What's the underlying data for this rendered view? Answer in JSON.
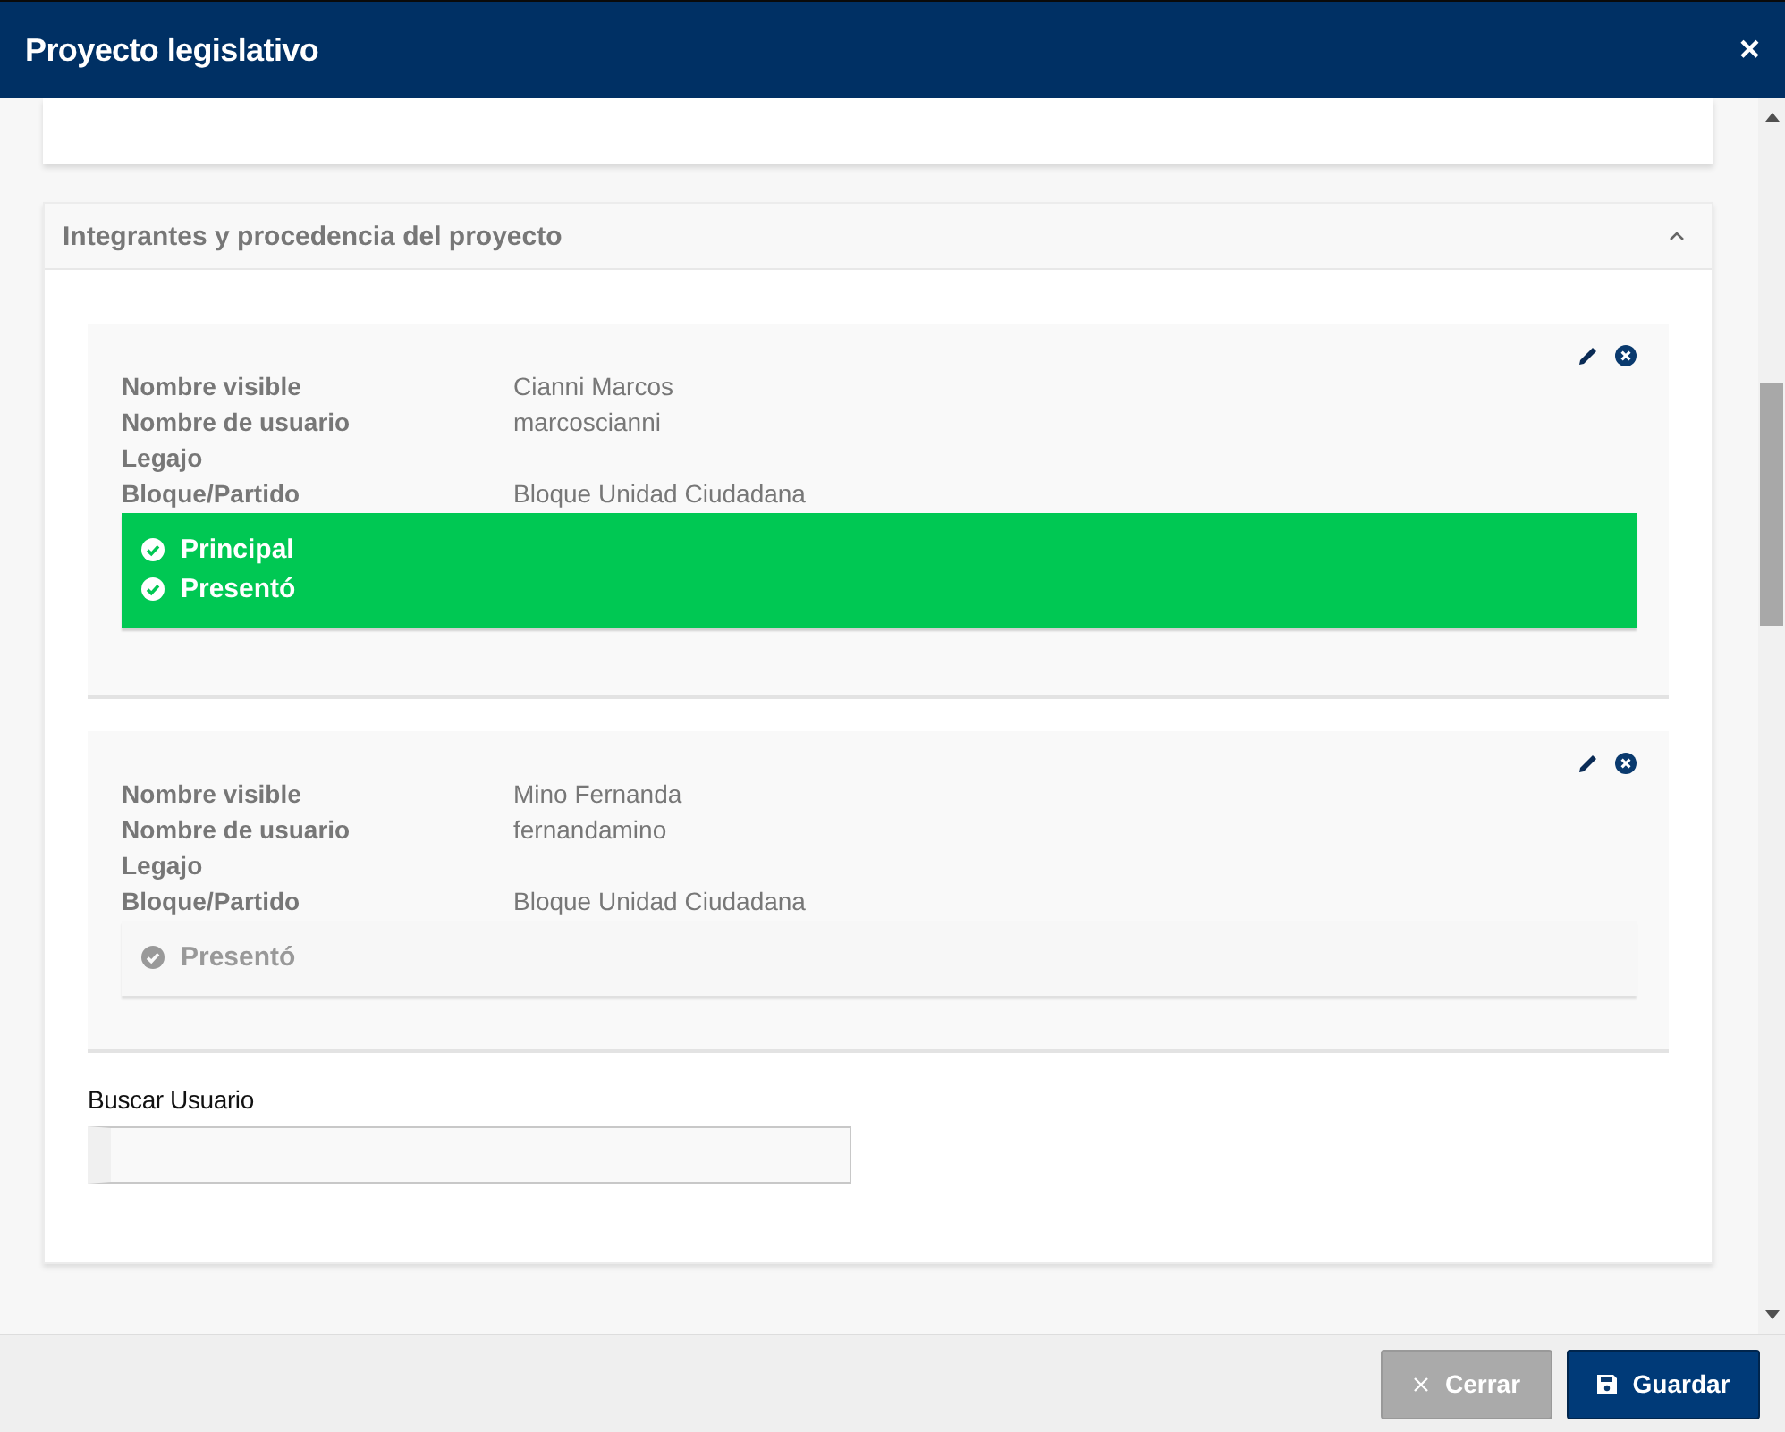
{
  "window": {
    "title": "Proyecto legislativo",
    "close": "×"
  },
  "section": {
    "title": "Integrantes y procedencia del proyecto",
    "expanded": true
  },
  "members": [
    {
      "fields": [
        {
          "label": "Nombre visible",
          "value": "Cianni Marcos"
        },
        {
          "label": "Nombre de usuario",
          "value": "marcoscianni"
        },
        {
          "label": "Legajo"
        },
        {
          "label": "Bloque/Partido",
          "value": "Bloque Unidad Ciudadana"
        }
      ],
      "highlighted": true,
      "flags": [
        {
          "label": "Principal"
        },
        {
          "label": "Presentó"
        }
      ]
    },
    {
      "fields": [
        {
          "label": "Nombre visible",
          "value": "Mino Fernanda"
        },
        {
          "label": "Nombre de usuario",
          "value": "fernandamino"
        },
        {
          "label": "Legajo"
        },
        {
          "label": "Bloque/Partido",
          "value": "Bloque Unidad Ciudadana"
        }
      ],
      "highlighted": false,
      "flags": [
        {
          "label": "Presentó"
        }
      ]
    }
  ],
  "search": {
    "label": "Buscar Usuario"
  },
  "buttons": [
    {
      "kind": "close",
      "label": "Cerrar"
    },
    {
      "kind": "save",
      "label": "Guardar"
    }
  ]
}
